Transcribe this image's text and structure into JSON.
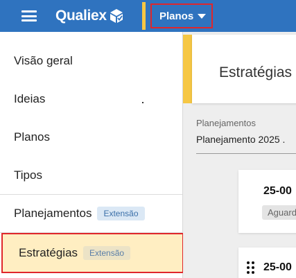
{
  "header": {
    "brand": "Qualiex",
    "menu_icon": "hamburger-menu-icon",
    "logo_icon": "qualiex-cube-logo",
    "module_selector": {
      "label": "Planos",
      "icon": "caret-down-icon"
    },
    "colors": {
      "bar": "#2f73bf",
      "accent": "#f6c744",
      "highlight_border": "#e0262b"
    }
  },
  "sidebar": {
    "items": [
      {
        "label": "Visão geral"
      },
      {
        "label": "Ideias"
      },
      {
        "label": "Planos"
      },
      {
        "label": "Tipos"
      },
      {
        "label": "Planejamentos",
        "badge": "Extensão"
      },
      {
        "label": "Estratégias",
        "badge": "Extensão",
        "active": true
      }
    ],
    "colors": {
      "active_bg": "#ffeec2",
      "badge_bg": "#dbe8f5"
    }
  },
  "main": {
    "title": "Estratégias",
    "filter": {
      "label": "Planejamentos",
      "value": "Planejamento 2025 ."
    },
    "cards": [
      {
        "code": "25-00",
        "status": "Aguard"
      },
      {
        "code": "25-00",
        "icon": "drag-handle-icon"
      }
    ]
  }
}
